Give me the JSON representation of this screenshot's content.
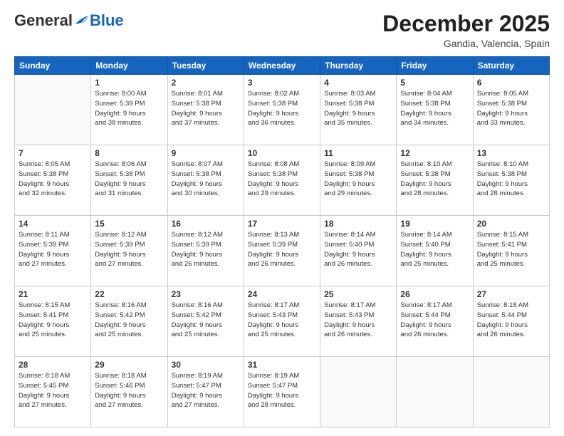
{
  "logo": {
    "general": "General",
    "blue": "Blue"
  },
  "title": "December 2025",
  "location": "Gandia, Valencia, Spain",
  "days": [
    "Sunday",
    "Monday",
    "Tuesday",
    "Wednesday",
    "Thursday",
    "Friday",
    "Saturday"
  ],
  "weeks": [
    [
      {
        "day": "",
        "info": ""
      },
      {
        "day": "1",
        "info": "Sunrise: 8:00 AM\nSunset: 5:39 PM\nDaylight: 9 hours\nand 38 minutes."
      },
      {
        "day": "2",
        "info": "Sunrise: 8:01 AM\nSunset: 5:38 PM\nDaylight: 9 hours\nand 37 minutes."
      },
      {
        "day": "3",
        "info": "Sunrise: 8:02 AM\nSunset: 5:38 PM\nDaylight: 9 hours\nand 36 minutes."
      },
      {
        "day": "4",
        "info": "Sunrise: 8:03 AM\nSunset: 5:38 PM\nDaylight: 9 hours\nand 35 minutes."
      },
      {
        "day": "5",
        "info": "Sunrise: 8:04 AM\nSunset: 5:38 PM\nDaylight: 9 hours\nand 34 minutes."
      },
      {
        "day": "6",
        "info": "Sunrise: 8:05 AM\nSunset: 5:38 PM\nDaylight: 9 hours\nand 33 minutes."
      }
    ],
    [
      {
        "day": "7",
        "info": "Sunrise: 8:05 AM\nSunset: 5:38 PM\nDaylight: 9 hours\nand 32 minutes."
      },
      {
        "day": "8",
        "info": "Sunrise: 8:06 AM\nSunset: 5:38 PM\nDaylight: 9 hours\nand 31 minutes."
      },
      {
        "day": "9",
        "info": "Sunrise: 8:07 AM\nSunset: 5:38 PM\nDaylight: 9 hours\nand 30 minutes."
      },
      {
        "day": "10",
        "info": "Sunrise: 8:08 AM\nSunset: 5:38 PM\nDaylight: 9 hours\nand 29 minutes."
      },
      {
        "day": "11",
        "info": "Sunrise: 8:09 AM\nSunset: 5:38 PM\nDaylight: 9 hours\nand 29 minutes."
      },
      {
        "day": "12",
        "info": "Sunrise: 8:10 AM\nSunset: 5:38 PM\nDaylight: 9 hours\nand 28 minutes."
      },
      {
        "day": "13",
        "info": "Sunrise: 8:10 AM\nSunset: 5:38 PM\nDaylight: 9 hours\nand 28 minutes."
      }
    ],
    [
      {
        "day": "14",
        "info": "Sunrise: 8:11 AM\nSunset: 5:39 PM\nDaylight: 9 hours\nand 27 minutes."
      },
      {
        "day": "15",
        "info": "Sunrise: 8:12 AM\nSunset: 5:39 PM\nDaylight: 9 hours\nand 27 minutes."
      },
      {
        "day": "16",
        "info": "Sunrise: 8:12 AM\nSunset: 5:39 PM\nDaylight: 9 hours\nand 26 minutes."
      },
      {
        "day": "17",
        "info": "Sunrise: 8:13 AM\nSunset: 5:39 PM\nDaylight: 9 hours\nand 26 minutes."
      },
      {
        "day": "18",
        "info": "Sunrise: 8:14 AM\nSunset: 5:40 PM\nDaylight: 9 hours\nand 26 minutes."
      },
      {
        "day": "19",
        "info": "Sunrise: 8:14 AM\nSunset: 5:40 PM\nDaylight: 9 hours\nand 25 minutes."
      },
      {
        "day": "20",
        "info": "Sunrise: 8:15 AM\nSunset: 5:41 PM\nDaylight: 9 hours\nand 25 minutes."
      }
    ],
    [
      {
        "day": "21",
        "info": "Sunrise: 8:15 AM\nSunset: 5:41 PM\nDaylight: 9 hours\nand 25 minutes."
      },
      {
        "day": "22",
        "info": "Sunrise: 8:16 AM\nSunset: 5:42 PM\nDaylight: 9 hours\nand 25 minutes."
      },
      {
        "day": "23",
        "info": "Sunrise: 8:16 AM\nSunset: 5:42 PM\nDaylight: 9 hours\nand 25 minutes."
      },
      {
        "day": "24",
        "info": "Sunrise: 8:17 AM\nSunset: 5:43 PM\nDaylight: 9 hours\nand 25 minutes."
      },
      {
        "day": "25",
        "info": "Sunrise: 8:17 AM\nSunset: 5:43 PM\nDaylight: 9 hours\nand 26 minutes."
      },
      {
        "day": "26",
        "info": "Sunrise: 8:17 AM\nSunset: 5:44 PM\nDaylight: 9 hours\nand 26 minutes."
      },
      {
        "day": "27",
        "info": "Sunrise: 8:18 AM\nSunset: 5:44 PM\nDaylight: 9 hours\nand 26 minutes."
      }
    ],
    [
      {
        "day": "28",
        "info": "Sunrise: 8:18 AM\nSunset: 5:45 PM\nDaylight: 9 hours\nand 27 minutes."
      },
      {
        "day": "29",
        "info": "Sunrise: 8:18 AM\nSunset: 5:46 PM\nDaylight: 9 hours\nand 27 minutes."
      },
      {
        "day": "30",
        "info": "Sunrise: 8:19 AM\nSunset: 5:47 PM\nDaylight: 9 hours\nand 27 minutes."
      },
      {
        "day": "31",
        "info": "Sunrise: 8:19 AM\nSunset: 5:47 PM\nDaylight: 9 hours\nand 28 minutes."
      },
      {
        "day": "",
        "info": ""
      },
      {
        "day": "",
        "info": ""
      },
      {
        "day": "",
        "info": ""
      }
    ]
  ]
}
